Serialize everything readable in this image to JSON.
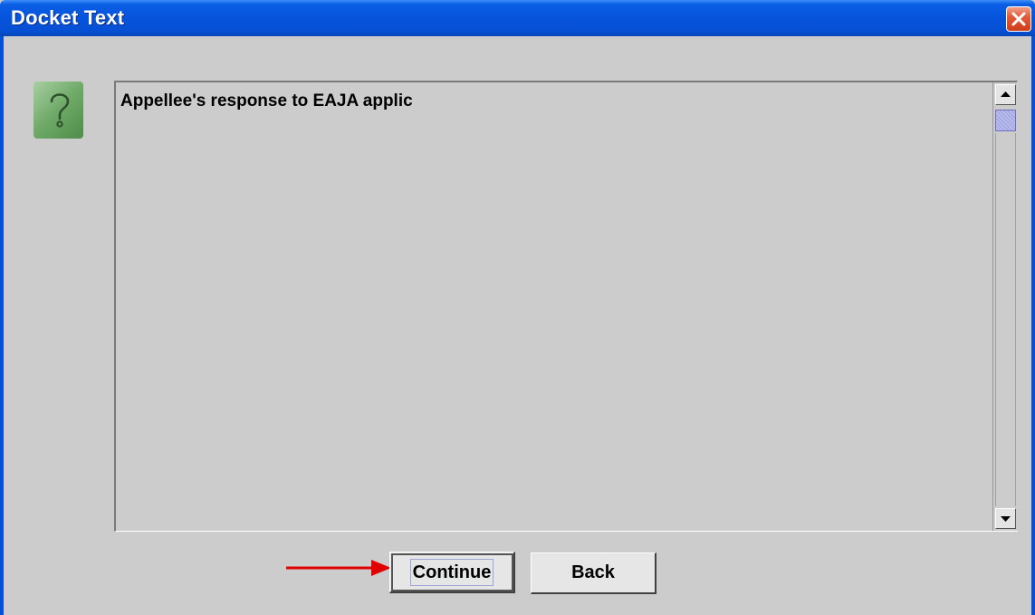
{
  "window": {
    "title": "Docket Text",
    "close_icon": "close-icon"
  },
  "dialog": {
    "icon": "question-icon",
    "docket_text": "Appellee's response to EAJA applic"
  },
  "buttons": {
    "continue_label": "Continue",
    "back_label": "Back"
  },
  "colors": {
    "titlebar": "#0550d4",
    "close_button": "#e25c3a",
    "annotation_arrow": "#e00000"
  }
}
